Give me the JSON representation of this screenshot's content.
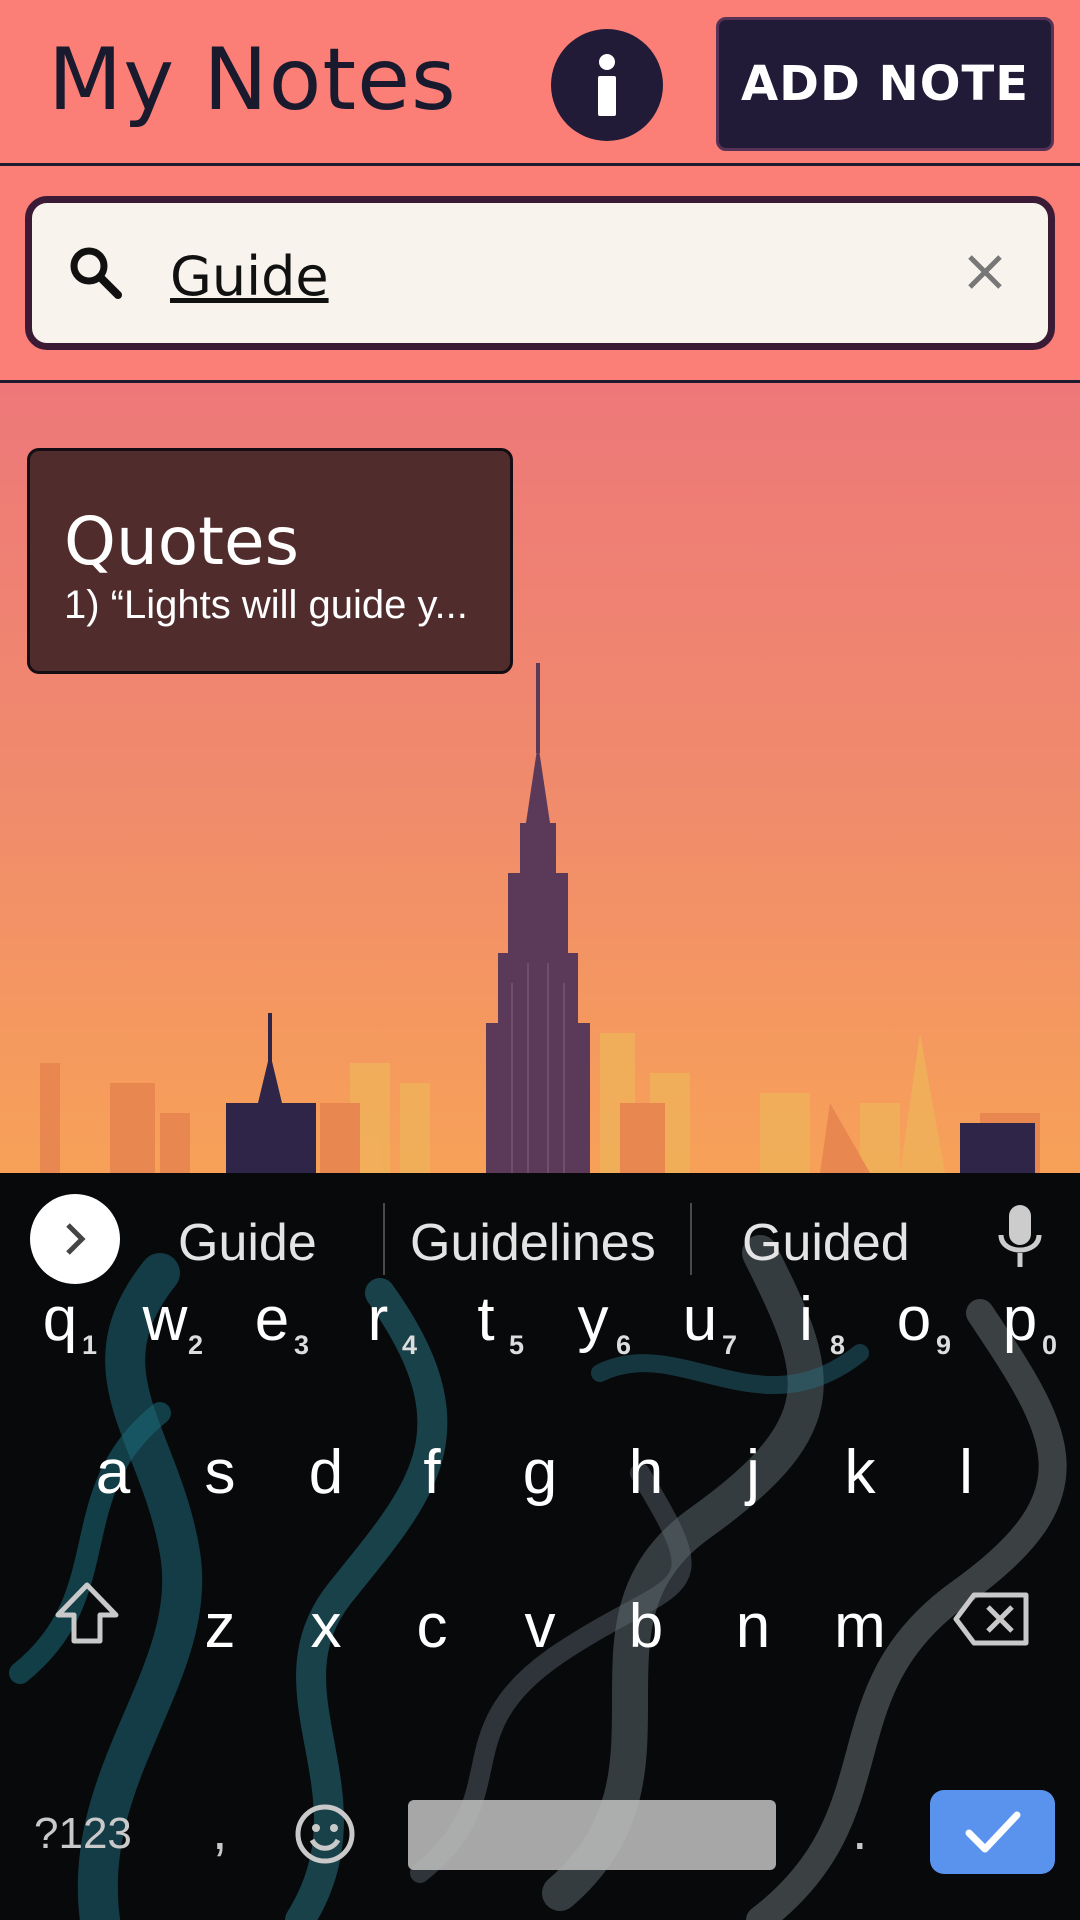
{
  "header": {
    "title": "My Notes",
    "info_label": "i",
    "add_label": "ADD NOTE"
  },
  "search": {
    "value": "Guide",
    "placeholder": ""
  },
  "notes": [
    {
      "title": "Quotes",
      "preview": "1) “Lights will guide y..."
    }
  ],
  "keyboard": {
    "suggestions": [
      "Guide",
      "Guidelines",
      "Guided"
    ],
    "row1": [
      "q",
      "w",
      "e",
      "r",
      "t",
      "y",
      "u",
      "i",
      "o",
      "p"
    ],
    "row1_hints": [
      "1",
      "2",
      "3",
      "4",
      "5",
      "6",
      "7",
      "8",
      "9",
      "0"
    ],
    "row2": [
      "a",
      "s",
      "d",
      "f",
      "g",
      "h",
      "j",
      "k",
      "l"
    ],
    "row3": [
      "z",
      "x",
      "c",
      "v",
      "b",
      "n",
      "m"
    ],
    "symbols_label": "?123",
    "comma": ",",
    "period": "."
  },
  "colors": {
    "header_bg": "#fb7f77",
    "dark_navy": "#221b37",
    "card_bg": "#512c2d",
    "enter_blue": "#5a93ed"
  }
}
